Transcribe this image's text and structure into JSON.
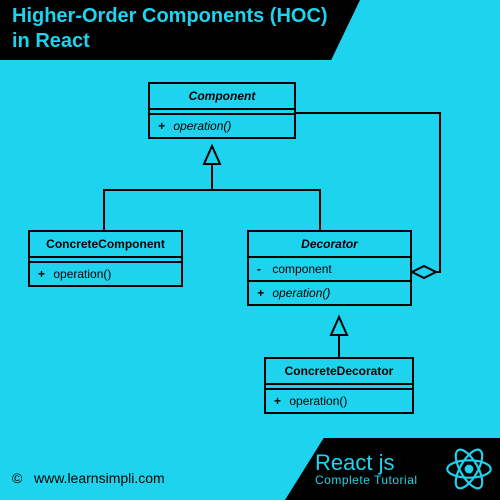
{
  "header": {
    "title_line1": "Higher-Order Components (HOC)",
    "title_line2": "in React"
  },
  "classes": {
    "component": {
      "name": "Component",
      "op_vis": "+",
      "op": "operation()"
    },
    "concreteComponent": {
      "name": "ConcreteComponent",
      "op_vis": "+",
      "op": "operation()"
    },
    "decorator": {
      "name": "Decorator",
      "attr_vis": "-",
      "attr": "component",
      "op_vis": "+",
      "op": "operation()"
    },
    "concreteDecorator": {
      "name": "ConcreteDecorator",
      "op_vis": "+",
      "op": "operation()"
    }
  },
  "footer": {
    "title": "React js",
    "subtitle": "Complete Tutorial"
  },
  "copyright": {
    "symbol": "©",
    "text": "www.learnsimpli.com"
  }
}
